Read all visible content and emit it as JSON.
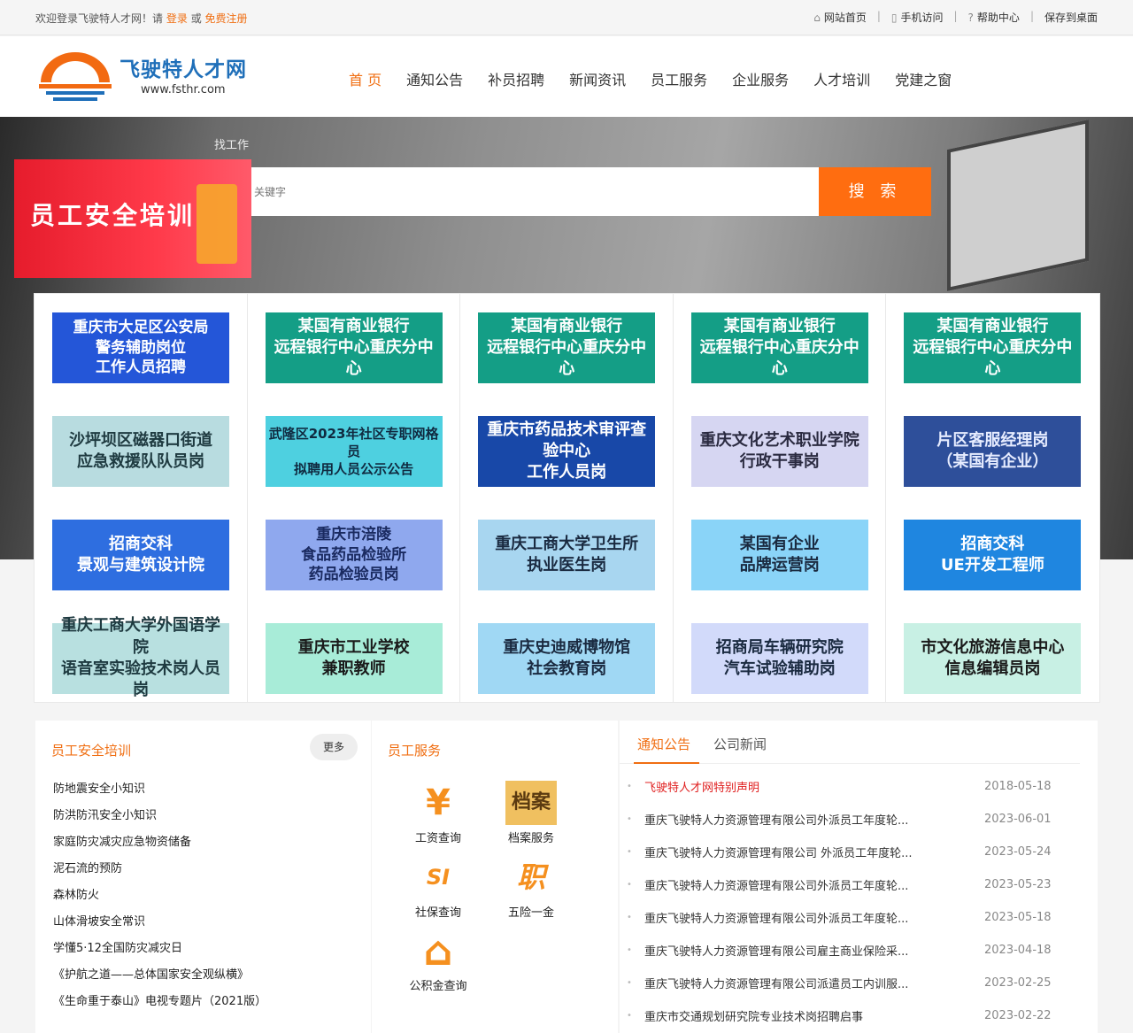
{
  "topbar": {
    "welcome_prefix": "欢迎登录飞驶特人才网！请",
    "login": "登录",
    "or": "或",
    "register": "免费注册",
    "links": [
      {
        "icon": "home-icon",
        "label": "网站首页"
      },
      {
        "icon": "phone-icon",
        "label": "手机访问"
      },
      {
        "icon": "help-icon",
        "label": "帮助中心"
      },
      {
        "icon": "",
        "label": "保存到桌面"
      }
    ]
  },
  "logo": {
    "title": "飞驶特人才网",
    "url": "www.fsthr.com"
  },
  "nav": [
    "首 页",
    "通知公告",
    "补员招聘",
    "新闻资讯",
    "员工服务",
    "企业服务",
    "人才培训",
    "党建之窗"
  ],
  "hero": {
    "find_job_label": "找工作",
    "search_placeholder": "关键字",
    "search_button": "搜 索",
    "promo_text": "员工安全培训"
  },
  "cards": [
    [
      {
        "lines": [
          "重庆市大足区公安局",
          "警务辅助岗位",
          "工作人员招聘"
        ],
        "bg": "#2456d8",
        "fg": "#ffffff"
      },
      {
        "lines": [
          "沙坪坝区磁器口街道",
          "应急救援队队员岗"
        ],
        "bg": "#b8dce0",
        "fg": "#1e3a40"
      },
      {
        "lines": [
          "招商交科",
          "景观与建筑设计院"
        ],
        "bg": "#2e6ee0",
        "fg": "#ffffff"
      },
      {
        "lines": [
          "重庆工商大学外国语学院",
          "语音室实验技术岗人员岗"
        ],
        "bg": "#b8e0e0",
        "fg": "#1e3a40"
      }
    ],
    [
      {
        "lines": [
          "某国有商业银行",
          "远程银行中心重庆分中心"
        ],
        "bg": "#149e86",
        "fg": "#ffffff"
      },
      {
        "lines": [
          "武隆区2023年社区专职网格员",
          "拟聘用人员公示公告"
        ],
        "bg": "#4ed0e0",
        "fg": "#102a40"
      },
      {
        "lines": [
          "重庆市涪陵",
          "食品药品检验所",
          "药品检验员岗"
        ],
        "bg": "#8fa8ee",
        "fg": "#1a2a60"
      },
      {
        "lines": [
          "重庆市工业学校",
          "兼职教师"
        ],
        "bg": "#a8ecd8",
        "fg": "#1a1a1a"
      }
    ],
    [
      {
        "lines": [
          "某国有商业银行",
          "远程银行中心重庆分中心"
        ],
        "bg": "#149e86",
        "fg": "#ffffff"
      },
      {
        "lines": [
          "重庆市药品技术审评查验中心",
          "工作人员岗"
        ],
        "bg": "#1848a8",
        "fg": "#ffffff"
      },
      {
        "lines": [
          "重庆工商大学卫生所",
          "执业医生岗"
        ],
        "bg": "#a8d6f0",
        "fg": "#1a2a40"
      },
      {
        "lines": [
          "重庆史迪威博物馆",
          "社会教育岗"
        ],
        "bg": "#a0d8f4",
        "fg": "#1a2a40"
      }
    ],
    [
      {
        "lines": [
          "某国有商业银行",
          "远程银行中心重庆分中心"
        ],
        "bg": "#149e86",
        "fg": "#ffffff"
      },
      {
        "lines": [
          "重庆文化艺术职业学院",
          "行政干事岗"
        ],
        "bg": "#d6d6f2",
        "fg": "#2a2a40"
      },
      {
        "lines": [
          "某国有企业",
          "品牌运营岗"
        ],
        "bg": "#8ad4f8",
        "fg": "#1a2a40"
      },
      {
        "lines": [
          "招商局车辆研究院",
          "汽车试验辅助岗"
        ],
        "bg": "#d2dafa",
        "fg": "#1a2a40"
      }
    ],
    [
      {
        "lines": [
          "某国有商业银行",
          "远程银行中心重庆分中心"
        ],
        "bg": "#149e86",
        "fg": "#ffffff"
      },
      {
        "lines": [
          "片区客服经理岗",
          "（某国有企业）"
        ],
        "bg": "#2e4f9a",
        "fg": "#e6ecff"
      },
      {
        "lines": [
          "招商交科",
          "UE开发工程师"
        ],
        "bg": "#1f86e0",
        "fg": "#ffffff"
      },
      {
        "lines": [
          "市文化旅游信息中心",
          "信息编辑员岗"
        ],
        "bg": "#c8f0e4",
        "fg": "#1a1a1a"
      }
    ]
  ],
  "training": {
    "title": "员工安全培训",
    "more": "更多",
    "items": [
      "防地震安全小知识",
      "防洪防汛安全小知识",
      "家庭防灾减灾应急物资储备",
      "泥石流的预防",
      "森林防火",
      "山体滑坡安全常识",
      "学懂5·12全国防灾减灾日",
      "《护航之道——总体国家安全观纵横》",
      "《生命重于泰山》电视专题片（2021版）"
    ]
  },
  "services": {
    "title": "员工服务",
    "items": [
      {
        "icon": "yen-icon",
        "glyph": "¥",
        "label": "工资查询"
      },
      {
        "icon": "archive-icon",
        "glyph": "档案",
        "label": "档案服务"
      },
      {
        "icon": "social-insurance-icon",
        "glyph": "SI",
        "label": "社保查询"
      },
      {
        "icon": "insurance-icon",
        "glyph": "职",
        "label": "五险一金"
      },
      {
        "icon": "house-icon",
        "glyph": "⌂",
        "label": "公积金查询"
      }
    ]
  },
  "notices": {
    "tabs": [
      "通知公告",
      "公司新闻"
    ],
    "items": [
      {
        "title": "飞驶特人才网特别声明",
        "date": "2018-05-18",
        "highlight": true
      },
      {
        "title": "重庆飞驶特人力资源管理有限公司外派员工年度轮...",
        "date": "2023-06-01"
      },
      {
        "title": "重庆飞驶特人力资源管理有限公司 外派员工年度轮...",
        "date": "2023-05-24"
      },
      {
        "title": "重庆飞驶特人力资源管理有限公司外派员工年度轮...",
        "date": "2023-05-23"
      },
      {
        "title": "重庆飞驶特人力资源管理有限公司外派员工年度轮...",
        "date": "2023-05-18"
      },
      {
        "title": "重庆飞驶特人力资源管理有限公司雇主商业保险采...",
        "date": "2023-04-18"
      },
      {
        "title": "重庆飞驶特人力资源管理有限公司派遣员工内训服...",
        "date": "2023-02-25"
      },
      {
        "title": "重庆市交通规划研究院专业技术岗招聘启事",
        "date": "2023-02-22"
      }
    ]
  },
  "colors": {
    "accent": "#f06e12",
    "brand_blue": "#1f6fb9",
    "search_button": "#ff6d10"
  }
}
